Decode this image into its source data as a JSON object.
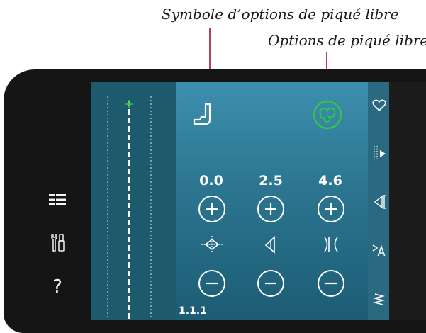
{
  "captions": {
    "symbol_label": "Symbole d’options de piqué libre",
    "options_label": "Options de piqué libre"
  },
  "left_toolbar": {
    "icons": [
      "menu-list-icon",
      "tools-icon",
      "help-icon"
    ],
    "help_glyph": "?"
  },
  "panel": {
    "values": [
      "0.0",
      "2.5",
      "4.6"
    ],
    "stitch_number": "1.1.1"
  },
  "right_toolbar": {
    "icons": [
      "heart-icon",
      "needle-thread-icon",
      "stitch-width-icon",
      "text-size-icon",
      "zigzag-icon"
    ]
  },
  "colors": {
    "accent_line": "#b5405a",
    "active_icon": "#35c24f",
    "panel_top": "#3c8fae",
    "panel_bottom": "#1c5c74"
  }
}
